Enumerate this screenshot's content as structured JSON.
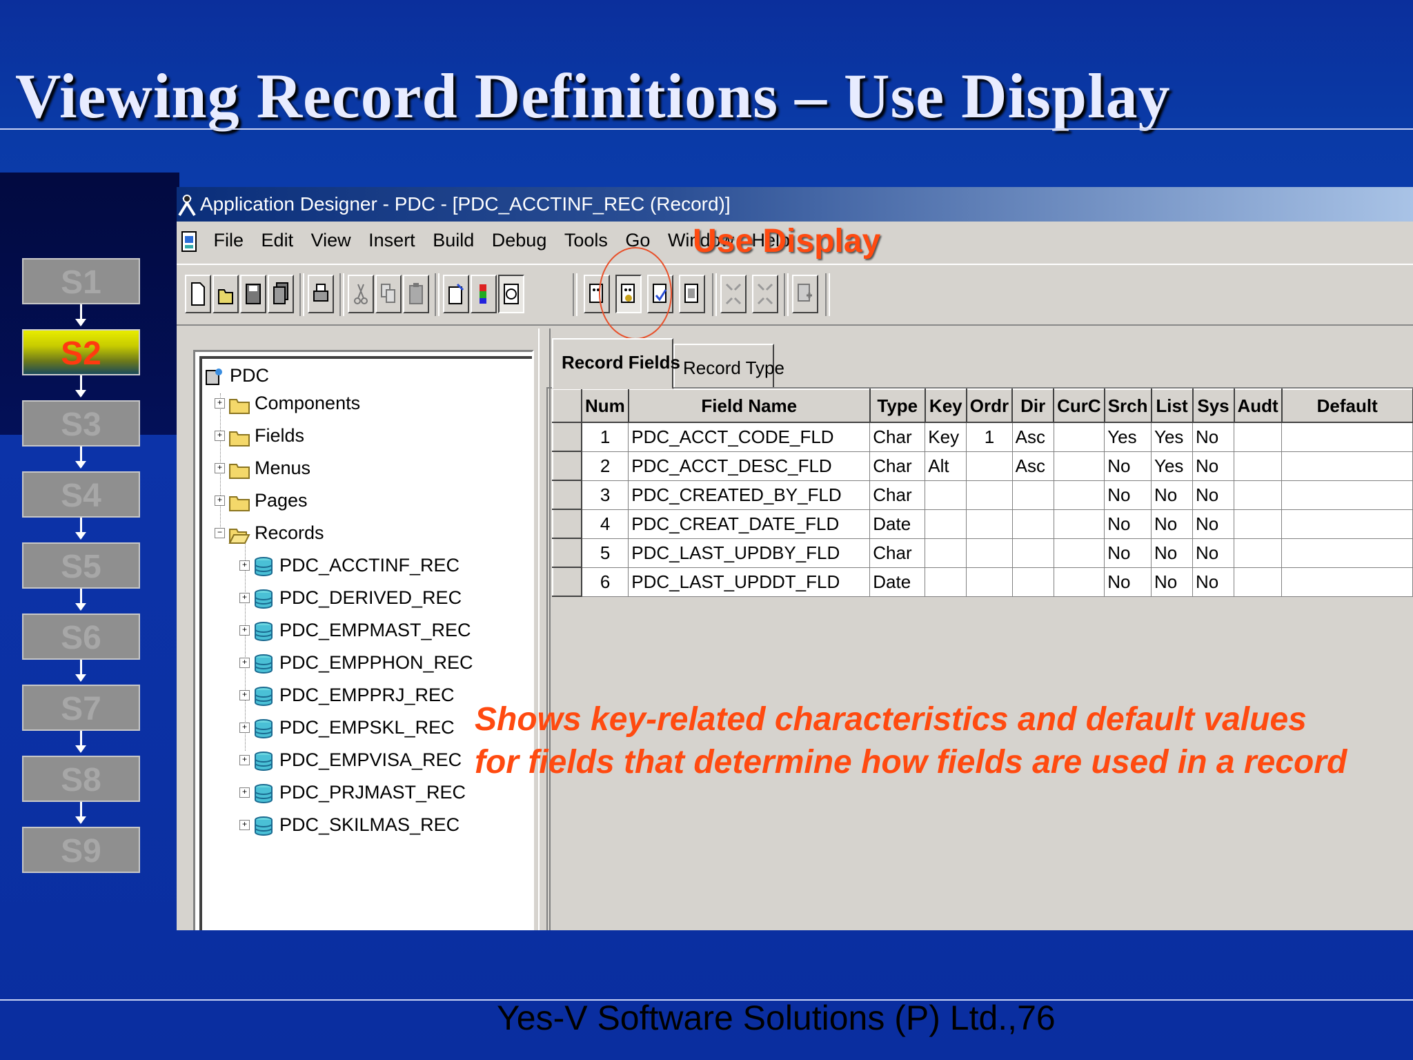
{
  "slide": {
    "title": "Viewing Record Definitions – Use Display",
    "footer": "Yes-V Software Solutions (P) Ltd.,76",
    "note_line1": "Shows key-related characteristics and default values",
    "note_line2": "for fields that determine how fields are used in a record",
    "callout": "Use Display"
  },
  "steps": [
    "S1",
    "S2",
    "S3",
    "S4",
    "S5",
    "S6",
    "S7",
    "S8",
    "S9"
  ],
  "active_step": "S2",
  "app": {
    "window_title": "Application Designer - PDC - [PDC_ACCTINF_REC (Record)]",
    "menu": [
      "File",
      "Edit",
      "View",
      "Insert",
      "Build",
      "Debug",
      "Tools",
      "Go",
      "Window",
      "Help"
    ],
    "tree": {
      "root": "PDC",
      "folders": [
        "Components",
        "Fields",
        "Menus",
        "Pages",
        "Records"
      ],
      "records": [
        "PDC_ACCTINF_REC",
        "PDC_DERIVED_REC",
        "PDC_EMPMAST_REC",
        "PDC_EMPPHON_REC",
        "PDC_EMPPRJ_REC",
        "PDC_EMPSKL_REC",
        "PDC_EMPVISA_REC",
        "PDC_PRJMAST_REC",
        "PDC_SKILMAS_REC"
      ]
    },
    "tabs": [
      "Record Fields",
      "Record Type"
    ],
    "grid": {
      "columns": [
        "Num",
        "Field Name",
        "Type",
        "Key",
        "Ordr",
        "Dir",
        "CurC",
        "Srch",
        "List",
        "Sys",
        "Audt",
        "Default"
      ],
      "rows": [
        [
          "1",
          "PDC_ACCT_CODE_FLD",
          "Char",
          "Key",
          "1",
          "Asc",
          "",
          "Yes",
          "Yes",
          "No",
          "",
          ""
        ],
        [
          "2",
          "PDC_ACCT_DESC_FLD",
          "Char",
          "Alt",
          "",
          "Asc",
          "",
          "No",
          "Yes",
          "No",
          "",
          ""
        ],
        [
          "3",
          "PDC_CREATED_BY_FLD",
          "Char",
          "",
          "",
          "",
          "",
          "No",
          "No",
          "No",
          "",
          ""
        ],
        [
          "4",
          "PDC_CREAT_DATE_FLD",
          "Date",
          "",
          "",
          "",
          "",
          "No",
          "No",
          "No",
          "",
          ""
        ],
        [
          "5",
          "PDC_LAST_UPDBY_FLD",
          "Char",
          "",
          "",
          "",
          "",
          "No",
          "No",
          "No",
          "",
          ""
        ],
        [
          "6",
          "PDC_LAST_UPDDT_FLD",
          "Date",
          "",
          "",
          "",
          "",
          "No",
          "No",
          "No",
          "",
          ""
        ]
      ]
    }
  },
  "colors": {
    "accent": "#ff4a10",
    "slide_bg": "#0c33a8",
    "window_bg": "#d6d3ce"
  }
}
